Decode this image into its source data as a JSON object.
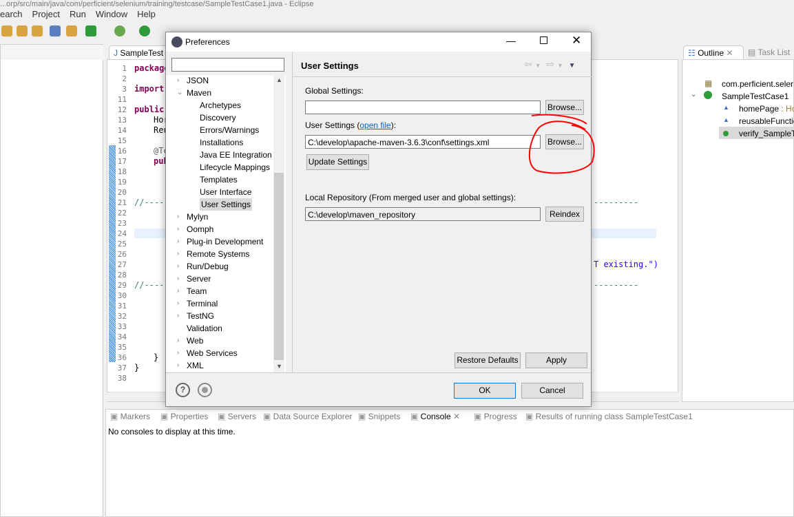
{
  "window": {
    "title": "...orp/src/main/java/com/perficient/selenium/training/testcase/SampleTestCase1.java - Eclipse"
  },
  "menu": [
    "earch",
    "Project",
    "Run",
    "Window",
    "Help"
  ],
  "editor": {
    "tab": "SampleTest",
    "line_numbers": [
      "1",
      "2",
      "3",
      "11",
      "12",
      "13",
      "14",
      "15",
      "16",
      "17",
      "18",
      "19",
      "20",
      "21",
      "22",
      "23",
      "24",
      "25",
      "26",
      "27",
      "28",
      "29",
      "30",
      "31",
      "32",
      "33",
      "34",
      "35",
      "36",
      "37",
      "38"
    ],
    "code": {
      "l1": "package",
      "l3": "import",
      "l12": "public",
      "l13": "Hor",
      "l14": "Reu",
      "l16": "@Te",
      "l17": "pub",
      "l21": "//-----",
      "l29": "//-----",
      "l36": "}",
      "l37": "}",
      "dash_right": "---------",
      "existing": "T existing.\")"
    }
  },
  "outline": {
    "tab": "Outline",
    "task_tab": "Task List",
    "items": [
      {
        "label": "com.perficient.seler"
      },
      {
        "label": "SampleTestCase1"
      },
      {
        "label": "homePage",
        "type": " : Ho"
      },
      {
        "label": "reusableFunctio"
      },
      {
        "label": "verify_SampleT"
      }
    ]
  },
  "bottom": {
    "tabs": [
      "Markers",
      "Properties",
      "Servers",
      "Data Source Explorer",
      "Snippets",
      "Console",
      "Progress",
      "Results of running class SampleTestCase1"
    ],
    "active": "Console",
    "message": "No consoles to display at this time."
  },
  "dialog": {
    "title": "Preferences",
    "filter_value": "",
    "tree": [
      {
        "label": "JSON",
        "level": 0
      },
      {
        "label": "Maven",
        "level": 0,
        "expanded": true
      },
      {
        "label": "Archetypes",
        "level": 1
      },
      {
        "label": "Discovery",
        "level": 1
      },
      {
        "label": "Errors/Warnings",
        "level": 1
      },
      {
        "label": "Installations",
        "level": 1
      },
      {
        "label": "Java EE Integration",
        "level": 1
      },
      {
        "label": "Lifecycle Mappings",
        "level": 1
      },
      {
        "label": "Templates",
        "level": 1
      },
      {
        "label": "User Interface",
        "level": 1
      },
      {
        "label": "User Settings",
        "level": 1,
        "selected": true
      },
      {
        "label": "Mylyn",
        "level": 0
      },
      {
        "label": "Oomph",
        "level": 0
      },
      {
        "label": "Plug-in Development",
        "level": 0
      },
      {
        "label": "Remote Systems",
        "level": 0
      },
      {
        "label": "Run/Debug",
        "level": 0
      },
      {
        "label": "Server",
        "level": 0
      },
      {
        "label": "Team",
        "level": 0
      },
      {
        "label": "Terminal",
        "level": 0
      },
      {
        "label": "TestNG",
        "level": 0
      },
      {
        "label": "Validation",
        "level": 0,
        "leaf": true
      },
      {
        "label": "Web",
        "level": 0
      },
      {
        "label": "Web Services",
        "level": 0
      },
      {
        "label": "XML",
        "level": 0
      }
    ],
    "page_title": "User Settings",
    "global_label": "Global Settings:",
    "global_value": "",
    "browse": "Browse...",
    "user_label": "User Settings (",
    "open_file": "open file",
    "user_label_end": "):",
    "user_value": "C:\\develop\\apache-maven-3.6.3\\conf\\settings.xml",
    "update": "Update Settings",
    "local_label": "Local Repository (From merged user and global settings):",
    "local_value": "C:\\develop\\maven_repository",
    "reindex": "Reindex",
    "restore": "Restore Defaults",
    "apply": "Apply",
    "ok": "OK",
    "cancel": "Cancel"
  },
  "colors": {
    "annotation": "#ff0000",
    "link": "#0066cc",
    "selected": "#cce8ff"
  }
}
